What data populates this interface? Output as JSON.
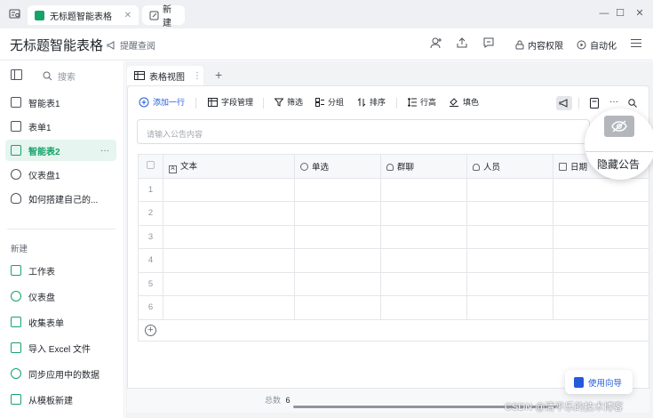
{
  "tabbar": {
    "active_tab": "无标题智能表格",
    "new_tab": "新建"
  },
  "header": {
    "title": "无标题智能表格",
    "remind_label": "提醒查阅",
    "permission_label": "内容权限",
    "automation_label": "自动化"
  },
  "sidebar": {
    "search_placeholder": "搜索",
    "items": [
      {
        "label": "智能表1",
        "icon": "smart-table-icon"
      },
      {
        "label": "表单1",
        "icon": "form-icon"
      },
      {
        "label": "智能表2",
        "icon": "smart-table-icon",
        "active": true
      },
      {
        "label": "仪表盘1",
        "icon": "dashboard-icon"
      },
      {
        "label": "如何搭建自己的...",
        "icon": "lightbulb-icon"
      }
    ],
    "new_section_label": "新建",
    "new_items": [
      {
        "label": "工作表",
        "icon": "worksheet-icon"
      },
      {
        "label": "仪表盘",
        "icon": "dashboard-icon"
      },
      {
        "label": "收集表单",
        "icon": "collect-form-icon"
      },
      {
        "label": "导入 Excel 文件",
        "icon": "import-excel-icon"
      },
      {
        "label": "同步应用中的数据",
        "icon": "sync-icon"
      },
      {
        "label": "从模板新建",
        "icon": "template-icon"
      }
    ]
  },
  "view": {
    "tab_label": "表格视图"
  },
  "toolbar": {
    "add_row": "添加一行",
    "field_manage": "字段管理",
    "filter": "筛选",
    "group": "分组",
    "sort": "排序",
    "row_height": "行高",
    "fill": "填色"
  },
  "notice": {
    "placeholder": "请输入公告内容",
    "hide_label": "隐藏公告"
  },
  "table": {
    "columns": [
      "文本",
      "单选",
      "群聊",
      "人员",
      "日期"
    ],
    "row_numbers": [
      "1",
      "2",
      "3",
      "4",
      "5",
      "6"
    ]
  },
  "footer": {
    "total_label": "总数",
    "total_value": "6"
  },
  "guide": {
    "label": "使用向导"
  },
  "watermark": "CSDN @清平乐的技术博客",
  "colors": {
    "accent_green": "#15a36a",
    "accent_blue": "#245bdb",
    "active_bg": "#e6f5ef"
  }
}
